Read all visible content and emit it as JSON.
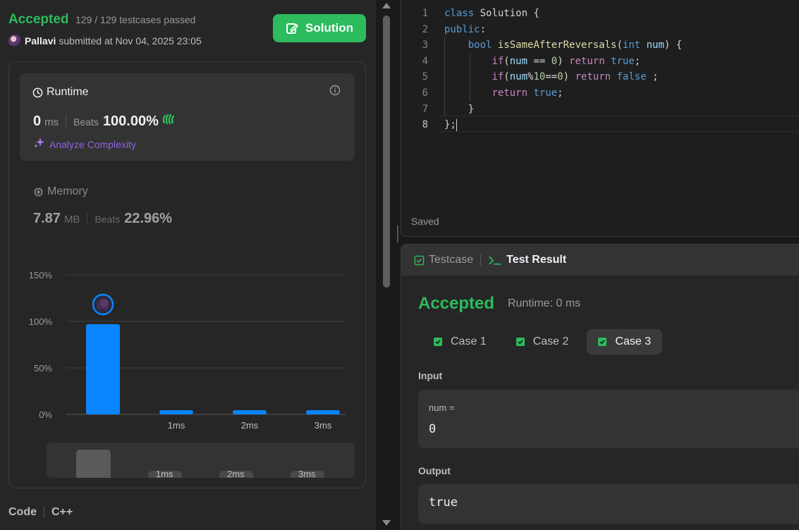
{
  "submission": {
    "status": "Accepted",
    "testcases": "129 / 129 testcases passed",
    "user": "Pallavi",
    "submitted_text": "submitted at Nov 04, 2025 23:05",
    "solution_label": "Solution"
  },
  "runtime": {
    "title": "Runtime",
    "value": "0",
    "unit": "ms",
    "beats_label": "Beats",
    "beats_value": "100.00%",
    "analyze_label": "Analyze Complexity"
  },
  "memory": {
    "title": "Memory",
    "value": "7.87",
    "unit": "MB",
    "beats_label": "Beats",
    "beats_value": "22.96%"
  },
  "chart_data": {
    "type": "bar",
    "categories": [
      "0ms",
      "1ms",
      "2ms",
      "3ms"
    ],
    "tick_labels": [
      "",
      "1ms",
      "2ms",
      "3ms"
    ],
    "values": [
      97,
      3,
      3,
      3
    ],
    "y_ticks": [
      "0%",
      "50%",
      "100%",
      "150%"
    ],
    "ylim": [
      0,
      150
    ],
    "highlight_index": 0,
    "minimap_labels": [
      "1ms",
      "2ms",
      "3ms"
    ],
    "bar_color": "#0a84ff"
  },
  "code_footer": {
    "label": "Code",
    "language": "C++"
  },
  "editor": {
    "line_numbers": [
      "1",
      "2",
      "3",
      "4",
      "5",
      "6",
      "7",
      "8"
    ],
    "status": "Saved"
  },
  "test_result": {
    "tabs": [
      "Testcase",
      "Test Result"
    ],
    "status": "Accepted",
    "runtime": "Runtime: 0 ms",
    "cases": [
      "Case 1",
      "Case 2",
      "Case 3"
    ],
    "selected_case": 2,
    "input_label": "Input",
    "input_var": "num =",
    "input_value": "0",
    "output_label": "Output",
    "output_value": "true"
  },
  "colors": {
    "accent_green": "#2cbb5d",
    "bar_blue": "#0a84ff",
    "purple": "#8d63e0"
  }
}
